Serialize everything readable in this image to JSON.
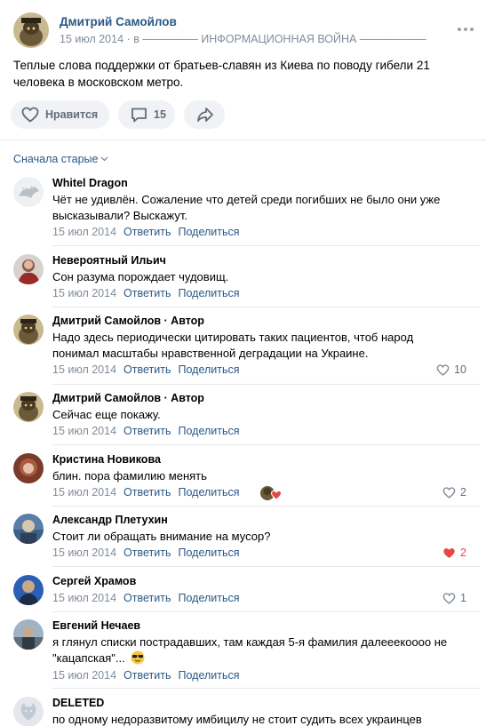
{
  "post": {
    "author": "Дмитрий Самойлов",
    "date": "15 июл 2014",
    "meta_sep": "·",
    "group_prefix": "в",
    "group": "————— ИНФОРМАЦИОННАЯ ВОЙНА ——————",
    "text": "Теплые слова поддержки от братьев-славян из Киева по поводу гибели 21 человека в московском метро.",
    "like_label": "Нравится",
    "comments_count": "15",
    "more_icon": "more-dots-icon"
  },
  "sort_label": "Сначала старые",
  "comment_actions": {
    "reply": "Ответить",
    "share": "Поделиться"
  },
  "comments": [
    {
      "author": "Whitel Dragon",
      "text": "Чёт не удивлён. Сожаление что детей среди погибших не было они уже высказывали? Выскажут.",
      "date": "15 июл 2014",
      "likes": ""
    },
    {
      "author": "Невероятный Ильич",
      "text": "Сон разума порождает чудовищ.",
      "date": "15 июл 2014",
      "likes": ""
    },
    {
      "author": "Дмитрий Самойлов · Автор",
      "text": "Надо здесь периодически цитировать таких пациентов, чтоб народ понимал масштабы нравственной деградации на Украине.",
      "date": "15 июл 2014",
      "likes": "10"
    },
    {
      "author": "Дмитрий Самойлов · Автор",
      "text": "Сейчас еще покажу.",
      "date": "15 июл 2014",
      "likes": ""
    },
    {
      "author": "Кристина Новикова",
      "text": "блин. пора фамилию менять",
      "date": "15 июл 2014",
      "likes": "2"
    },
    {
      "author": "Александр Плетухин",
      "text": "Стоит ли обращать внимание на мусор?",
      "date": "15 июл 2014",
      "likes": "2"
    },
    {
      "author": "Сергей Храмов",
      "text": "",
      "date": "15 июл 2014",
      "likes": "1"
    },
    {
      "author": "Евгений Нечаев",
      "text": "я глянул списки пострадавших, там каждая 5-я фамилия далееекоооо не \"кацапская\"...",
      "date": "15 июл 2014",
      "likes": ""
    },
    {
      "author": "DELETED",
      "text": "по одному недоразвитому имбицилу не стоит судить всех украинцев",
      "date": "",
      "likes": ""
    }
  ],
  "colors": {
    "link": "#2a5885",
    "meta": "#818c99",
    "liked": "#e64646"
  }
}
